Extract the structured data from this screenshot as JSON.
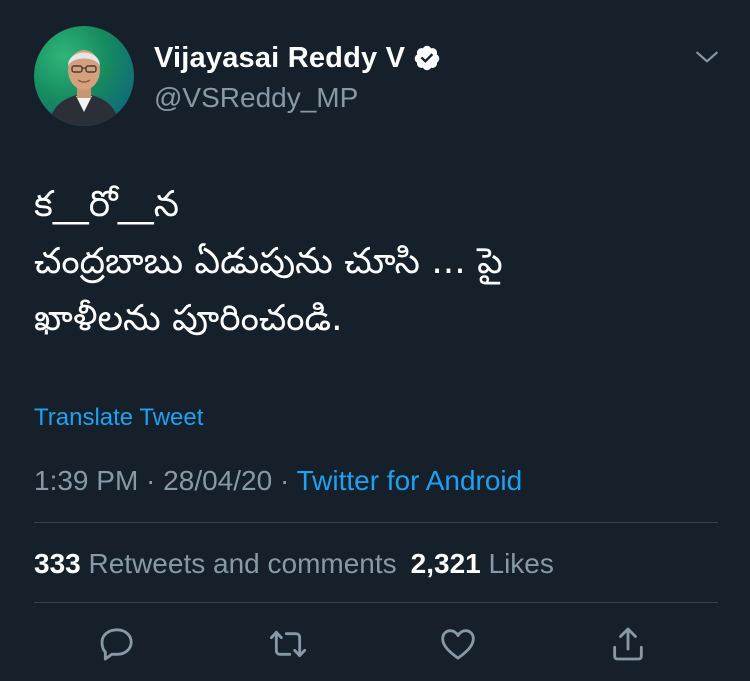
{
  "author": {
    "display_name": "Vijayasai Reddy V",
    "handle": "@VSReddy_MP",
    "verified": true,
    "avatar_icon": "profile-photo"
  },
  "tweet": {
    "lines": [
      "క__రో__న",
      "చంద్రబాబు ఏడుపును చూసి ... పై",
      "ఖాళీలను పూరించండి."
    ],
    "translate_label": "Translate Tweet"
  },
  "meta": {
    "time": "1:39 PM",
    "separator": " · ",
    "date": "28/04/20",
    "source": "Twitter for Android"
  },
  "stats": {
    "retweets_count": "333",
    "retweets_label": "Retweets and comments",
    "likes_count": "2,321",
    "likes_label": "Likes"
  },
  "actions": {
    "reply_icon": "reply-icon",
    "retweet_icon": "retweet-icon",
    "like_icon": "heart-icon",
    "share_icon": "share-icon"
  },
  "colors": {
    "background": "#15202b",
    "accent": "#1da1f2",
    "secondary_text": "#8899a6",
    "divider": "#38444d"
  }
}
